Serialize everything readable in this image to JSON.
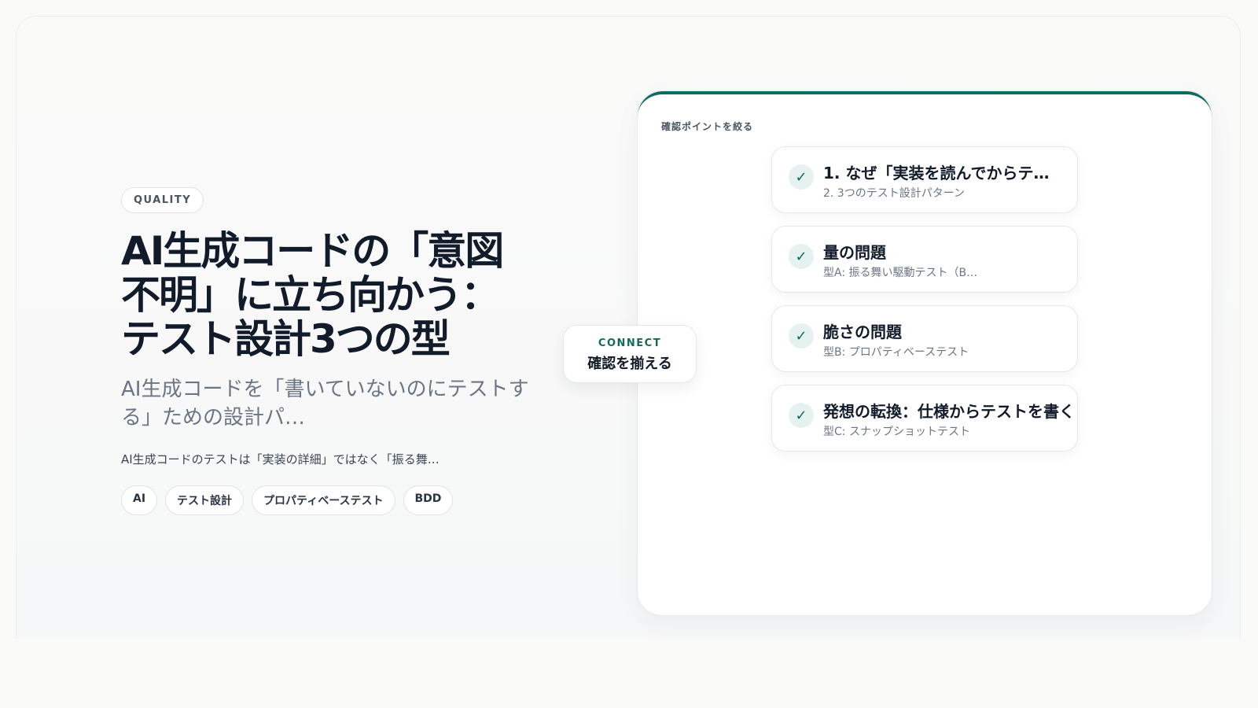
{
  "hero": {
    "badge": "QUALITY",
    "title": "AI生成コードの「意図不明」に立ち向かう：テスト設計3つの型",
    "subtitle": "AI生成コードを「書いていないのにテストする」ための設計パ…",
    "description": "AI生成コードのテストは「実装の詳細」ではなく「振る舞…",
    "tags": [
      "AI",
      "テスト設計",
      "プロパティベーステスト",
      "BDD"
    ]
  },
  "connect": {
    "label": "CONNECT",
    "text": "確認を揃える"
  },
  "panel": {
    "label": "確認ポイントを絞る",
    "items": [
      {
        "title": "1. なぜ「実装を読んでからテ…",
        "subtitle": "2. 3つのテスト設計パターン"
      },
      {
        "title": "量の問題",
        "subtitle": "型A: 振る舞い駆動テスト（B…"
      },
      {
        "title": "脆さの問題",
        "subtitle": "型B: プロパティベーステスト"
      },
      {
        "title": "発想の転換：仕様からテストを書く",
        "subtitle": "型C: スナップショットテスト"
      }
    ]
  },
  "icons": {
    "check": "check-icon"
  },
  "colors": {
    "accent": "#0f6b60",
    "text": "#121b29",
    "muted": "#6b7684"
  }
}
